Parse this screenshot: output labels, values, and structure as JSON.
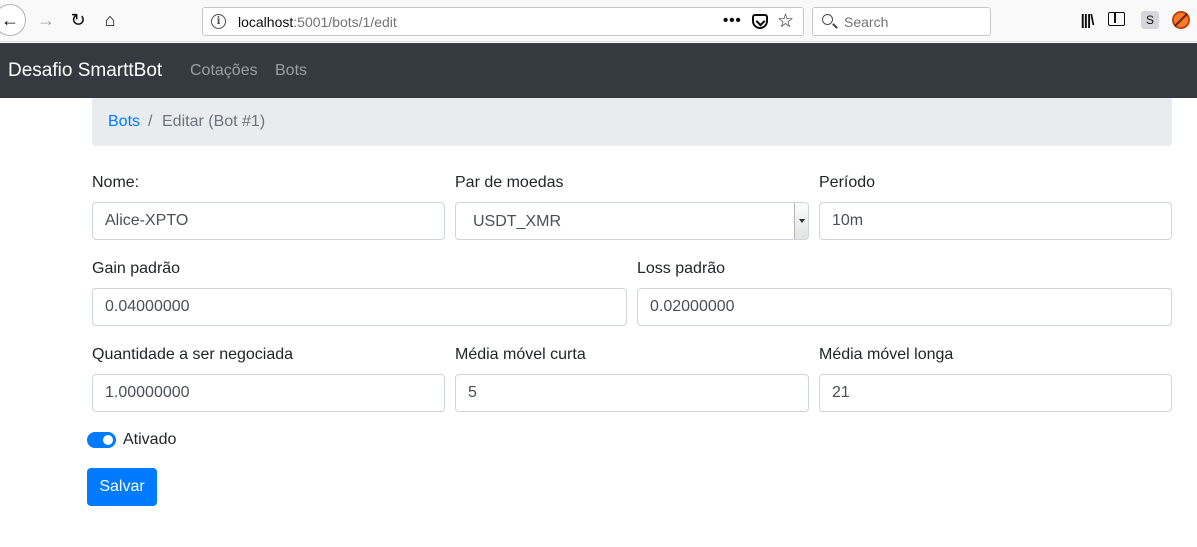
{
  "browser": {
    "url_host": "localhost",
    "url_rest": ":5001/bots/1/edit",
    "search_placeholder": "Search",
    "page_actions": "•••",
    "ext_s_label": "S"
  },
  "navbar": {
    "brand": "Desafio SmarttBot",
    "links": [
      {
        "label": "Cotações"
      },
      {
        "label": "Bots"
      }
    ]
  },
  "breadcrumb": {
    "link": "Bots",
    "separator": "/",
    "current": "Editar (Bot #1)"
  },
  "form": {
    "nome": {
      "label": "Nome:",
      "value": "Alice-XPTO"
    },
    "par_de_moedas": {
      "label": "Par de moedas",
      "value": "USDT_XMR"
    },
    "periodo": {
      "label": "Período",
      "value": "10m"
    },
    "gain_padrao": {
      "label": "Gain padrão",
      "value": "0.04000000"
    },
    "loss_padrao": {
      "label": "Loss padrão",
      "value": "0.02000000"
    },
    "quantidade": {
      "label": "Quantidade a ser negociada",
      "value": "1.00000000"
    },
    "media_curta": {
      "label": "Média móvel curta",
      "value": "5"
    },
    "media_longa": {
      "label": "Média móvel longa",
      "value": "21"
    },
    "ativado": {
      "label": "Ativado",
      "checked": true
    },
    "submit_label": "Salvar"
  },
  "colors": {
    "navbar_bg": "#343a40",
    "primary": "#007bff",
    "breadcrumb_bg": "#e9ecef"
  }
}
